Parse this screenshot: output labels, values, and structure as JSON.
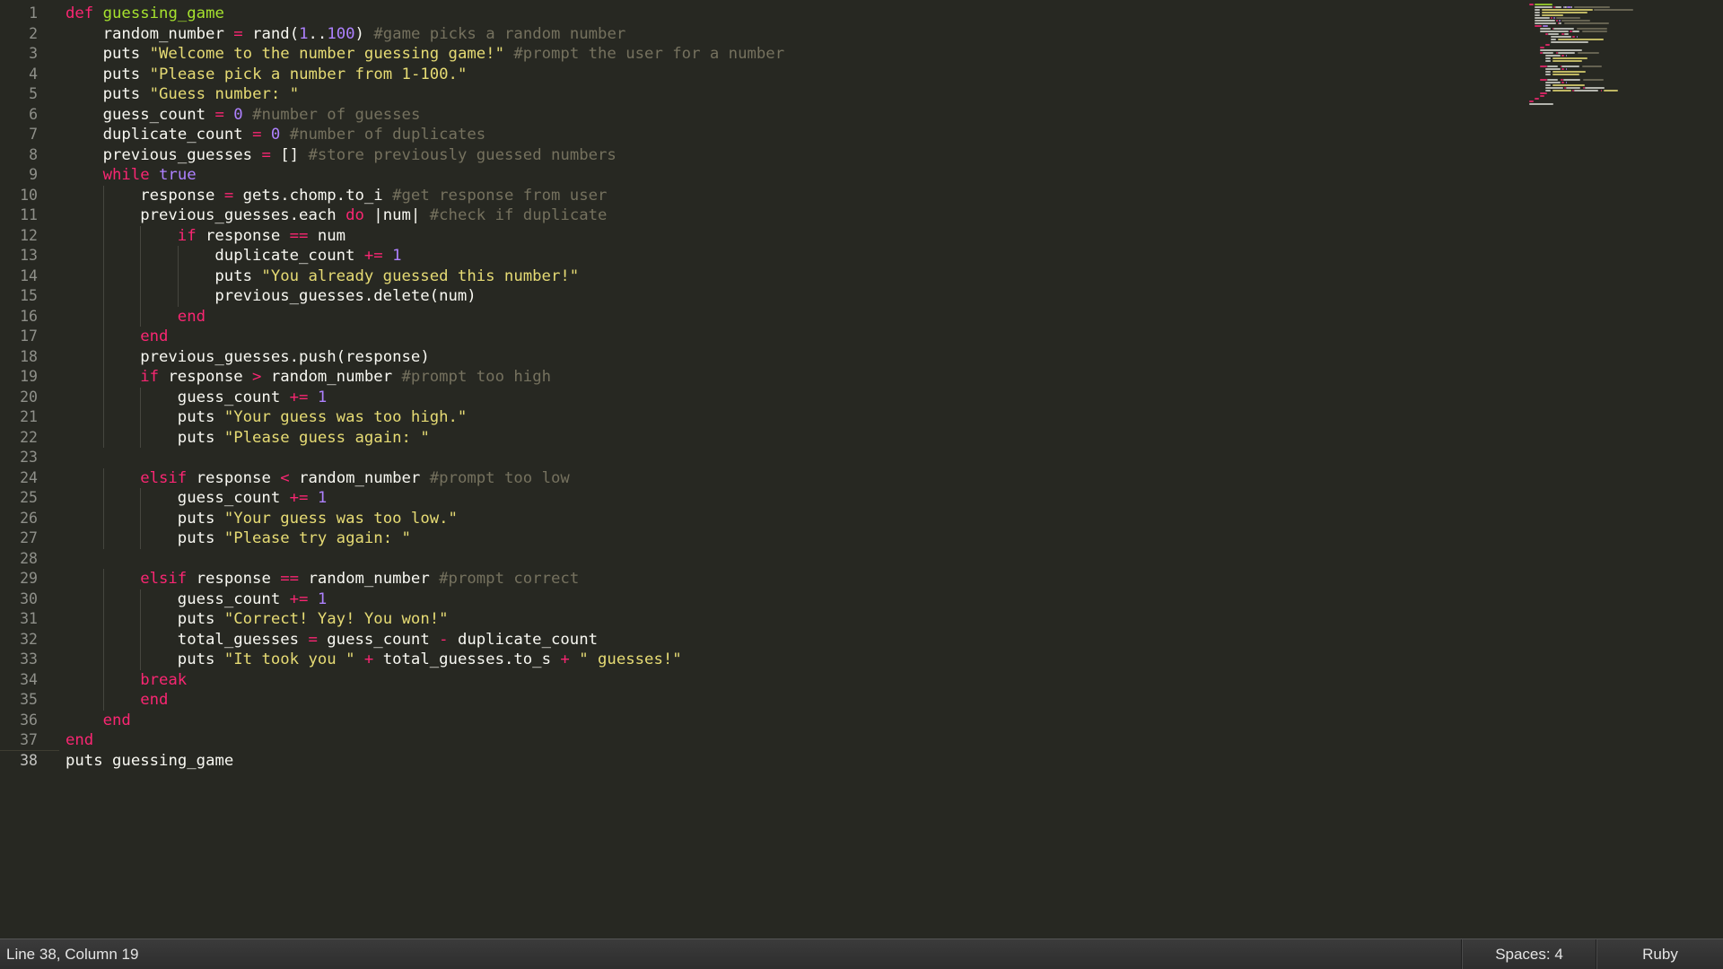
{
  "editor": {
    "lines": [
      {
        "n": "1",
        "indent": 0,
        "tokens": [
          [
            "kw",
            "def"
          ],
          [
            "",
            " "
          ],
          [
            "fn",
            "guessing_game"
          ]
        ]
      },
      {
        "n": "2",
        "indent": 1,
        "tokens": [
          [
            "",
            "random_number "
          ],
          [
            "op",
            "="
          ],
          [
            "",
            " rand("
          ],
          [
            "num",
            "1"
          ],
          [
            "",
            ".."
          ],
          [
            "num",
            "100"
          ],
          [
            "",
            ") "
          ],
          [
            "cm",
            "#game picks a random number"
          ]
        ]
      },
      {
        "n": "3",
        "indent": 1,
        "tokens": [
          [
            "",
            "puts "
          ],
          [
            "str",
            "\"Welcome to the number guessing game!\""
          ],
          [
            "",
            " "
          ],
          [
            "cm",
            "#prompt the user for a number"
          ]
        ]
      },
      {
        "n": "4",
        "indent": 1,
        "tokens": [
          [
            "",
            "puts "
          ],
          [
            "str",
            "\"Please pick a number from 1-100.\""
          ]
        ]
      },
      {
        "n": "5",
        "indent": 1,
        "tokens": [
          [
            "",
            "puts "
          ],
          [
            "str",
            "\"Guess number: \""
          ]
        ]
      },
      {
        "n": "6",
        "indent": 1,
        "tokens": [
          [
            "",
            "guess_count "
          ],
          [
            "op",
            "="
          ],
          [
            "",
            " "
          ],
          [
            "num",
            "0"
          ],
          [
            "",
            " "
          ],
          [
            "cm",
            "#number of guesses"
          ]
        ]
      },
      {
        "n": "7",
        "indent": 1,
        "tokens": [
          [
            "",
            "duplicate_count "
          ],
          [
            "op",
            "="
          ],
          [
            "",
            " "
          ],
          [
            "num",
            "0"
          ],
          [
            "",
            " "
          ],
          [
            "cm",
            "#number of duplicates"
          ]
        ]
      },
      {
        "n": "8",
        "indent": 1,
        "tokens": [
          [
            "",
            "previous_guesses "
          ],
          [
            "op",
            "="
          ],
          [
            "",
            " [] "
          ],
          [
            "cm",
            "#store previously guessed numbers"
          ]
        ]
      },
      {
        "n": "9",
        "indent": 1,
        "tokens": [
          [
            "kw",
            "while"
          ],
          [
            "",
            " "
          ],
          [
            "bool",
            "true"
          ]
        ]
      },
      {
        "n": "10",
        "indent": 2,
        "tokens": [
          [
            "",
            "response "
          ],
          [
            "op",
            "="
          ],
          [
            "",
            " gets.chomp.to_i "
          ],
          [
            "cm",
            "#get response from user"
          ]
        ]
      },
      {
        "n": "11",
        "indent": 2,
        "tokens": [
          [
            "",
            "previous_guesses.each "
          ],
          [
            "kw",
            "do"
          ],
          [
            "",
            " |num| "
          ],
          [
            "cm",
            "#check if duplicate"
          ]
        ]
      },
      {
        "n": "12",
        "indent": 3,
        "tokens": [
          [
            "kw",
            "if"
          ],
          [
            "",
            " response "
          ],
          [
            "op",
            "=="
          ],
          [
            "",
            " num"
          ]
        ]
      },
      {
        "n": "13",
        "indent": 4,
        "tokens": [
          [
            "",
            "duplicate_count "
          ],
          [
            "op",
            "+="
          ],
          [
            "",
            " "
          ],
          [
            "num",
            "1"
          ]
        ]
      },
      {
        "n": "14",
        "indent": 4,
        "tokens": [
          [
            "",
            "puts "
          ],
          [
            "str",
            "\"You already guessed this number!\""
          ]
        ]
      },
      {
        "n": "15",
        "indent": 4,
        "tokens": [
          [
            "",
            "previous_guesses.delete(num)"
          ]
        ]
      },
      {
        "n": "16",
        "indent": 3,
        "tokens": [
          [
            "kw",
            "end"
          ]
        ]
      },
      {
        "n": "17",
        "indent": 2,
        "tokens": [
          [
            "kw",
            "end"
          ]
        ]
      },
      {
        "n": "18",
        "indent": 2,
        "tokens": [
          [
            "",
            "previous_guesses.push(response)"
          ]
        ]
      },
      {
        "n": "19",
        "indent": 2,
        "tokens": [
          [
            "kw",
            "if"
          ],
          [
            "",
            " response "
          ],
          [
            "op",
            ">"
          ],
          [
            "",
            " random_number "
          ],
          [
            "cm",
            "#prompt too high"
          ]
        ]
      },
      {
        "n": "20",
        "indent": 3,
        "tokens": [
          [
            "",
            "guess_count "
          ],
          [
            "op",
            "+="
          ],
          [
            "",
            " "
          ],
          [
            "num",
            "1"
          ]
        ]
      },
      {
        "n": "21",
        "indent": 3,
        "tokens": [
          [
            "",
            "puts "
          ],
          [
            "str",
            "\"Your guess was too high.\""
          ]
        ]
      },
      {
        "n": "22",
        "indent": 3,
        "tokens": [
          [
            "",
            "puts "
          ],
          [
            "str",
            "\"Please guess again: \""
          ]
        ]
      },
      {
        "n": "23",
        "indent": 0,
        "tokens": []
      },
      {
        "n": "24",
        "indent": 2,
        "tokens": [
          [
            "kw",
            "elsif"
          ],
          [
            "",
            " response "
          ],
          [
            "op",
            "<"
          ],
          [
            "",
            " random_number "
          ],
          [
            "cm",
            "#prompt too low"
          ]
        ]
      },
      {
        "n": "25",
        "indent": 3,
        "tokens": [
          [
            "",
            "guess_count "
          ],
          [
            "op",
            "+="
          ],
          [
            "",
            " "
          ],
          [
            "num",
            "1"
          ]
        ]
      },
      {
        "n": "26",
        "indent": 3,
        "tokens": [
          [
            "",
            "puts "
          ],
          [
            "str",
            "\"Your guess was too low.\""
          ]
        ]
      },
      {
        "n": "27",
        "indent": 3,
        "tokens": [
          [
            "",
            "puts "
          ],
          [
            "str",
            "\"Please try again: \""
          ]
        ]
      },
      {
        "n": "28",
        "indent": 0,
        "tokens": []
      },
      {
        "n": "29",
        "indent": 2,
        "tokens": [
          [
            "kw",
            "elsif"
          ],
          [
            "",
            " response "
          ],
          [
            "op",
            "=="
          ],
          [
            "",
            " random_number "
          ],
          [
            "cm",
            "#prompt correct"
          ]
        ]
      },
      {
        "n": "30",
        "indent": 3,
        "tokens": [
          [
            "",
            "guess_count "
          ],
          [
            "op",
            "+="
          ],
          [
            "",
            " "
          ],
          [
            "num",
            "1"
          ]
        ]
      },
      {
        "n": "31",
        "indent": 3,
        "tokens": [
          [
            "",
            "puts "
          ],
          [
            "str",
            "\"Correct! Yay! You won!\""
          ]
        ]
      },
      {
        "n": "32",
        "indent": 3,
        "tokens": [
          [
            "",
            "total_guesses "
          ],
          [
            "op",
            "="
          ],
          [
            "",
            " guess_count "
          ],
          [
            "op",
            "-"
          ],
          [
            "",
            " duplicate_count"
          ]
        ]
      },
      {
        "n": "33",
        "indent": 3,
        "tokens": [
          [
            "",
            "puts "
          ],
          [
            "str",
            "\"It took you \""
          ],
          [
            "",
            " "
          ],
          [
            "op",
            "+"
          ],
          [
            "",
            " total_guesses.to_s "
          ],
          [
            "op",
            "+"
          ],
          [
            "",
            " "
          ],
          [
            "str",
            "\" guesses!\""
          ]
        ]
      },
      {
        "n": "34",
        "indent": 2,
        "tokens": [
          [
            "kw",
            "break"
          ]
        ]
      },
      {
        "n": "35",
        "indent": 2,
        "tokens": [
          [
            "kw",
            "end"
          ]
        ]
      },
      {
        "n": "36",
        "indent": 1,
        "tokens": [
          [
            "kw",
            "end"
          ]
        ]
      },
      {
        "n": "37",
        "indent": 0,
        "tokens": [
          [
            "kw",
            "end"
          ]
        ]
      },
      {
        "n": "38",
        "indent": 0,
        "tokens": [
          [
            "",
            "puts guessing_game"
          ]
        ]
      }
    ],
    "current_line": "38",
    "colors": {
      "background": "#272822",
      "keyword": "#f92672",
      "function": "#a6e22e",
      "number": "#ae81ff",
      "string": "#e6db74",
      "comment": "#75715e",
      "text": "#f8f8f2"
    }
  },
  "statusbar": {
    "position": "Line 38, Column 19",
    "indentation": "Spaces: 4",
    "syntax": "Ruby"
  }
}
